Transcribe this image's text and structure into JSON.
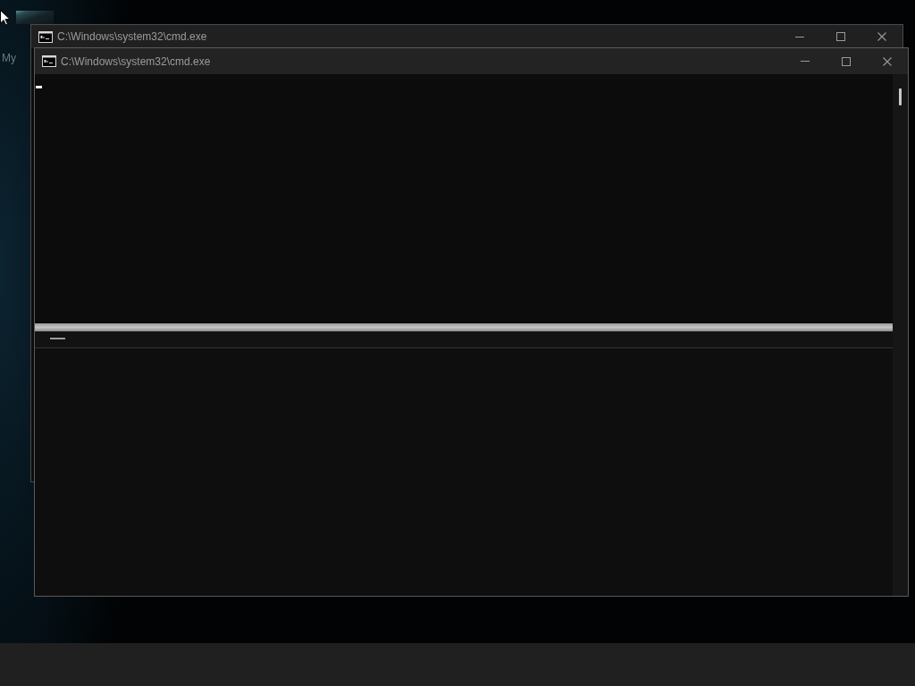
{
  "desktop": {
    "icon_labels": [
      "My"
    ]
  },
  "windows": [
    {
      "title": "C:\\Windows\\system32\\cmd.exe"
    },
    {
      "title": "C:\\Windows\\system32\\cmd.exe"
    }
  ]
}
